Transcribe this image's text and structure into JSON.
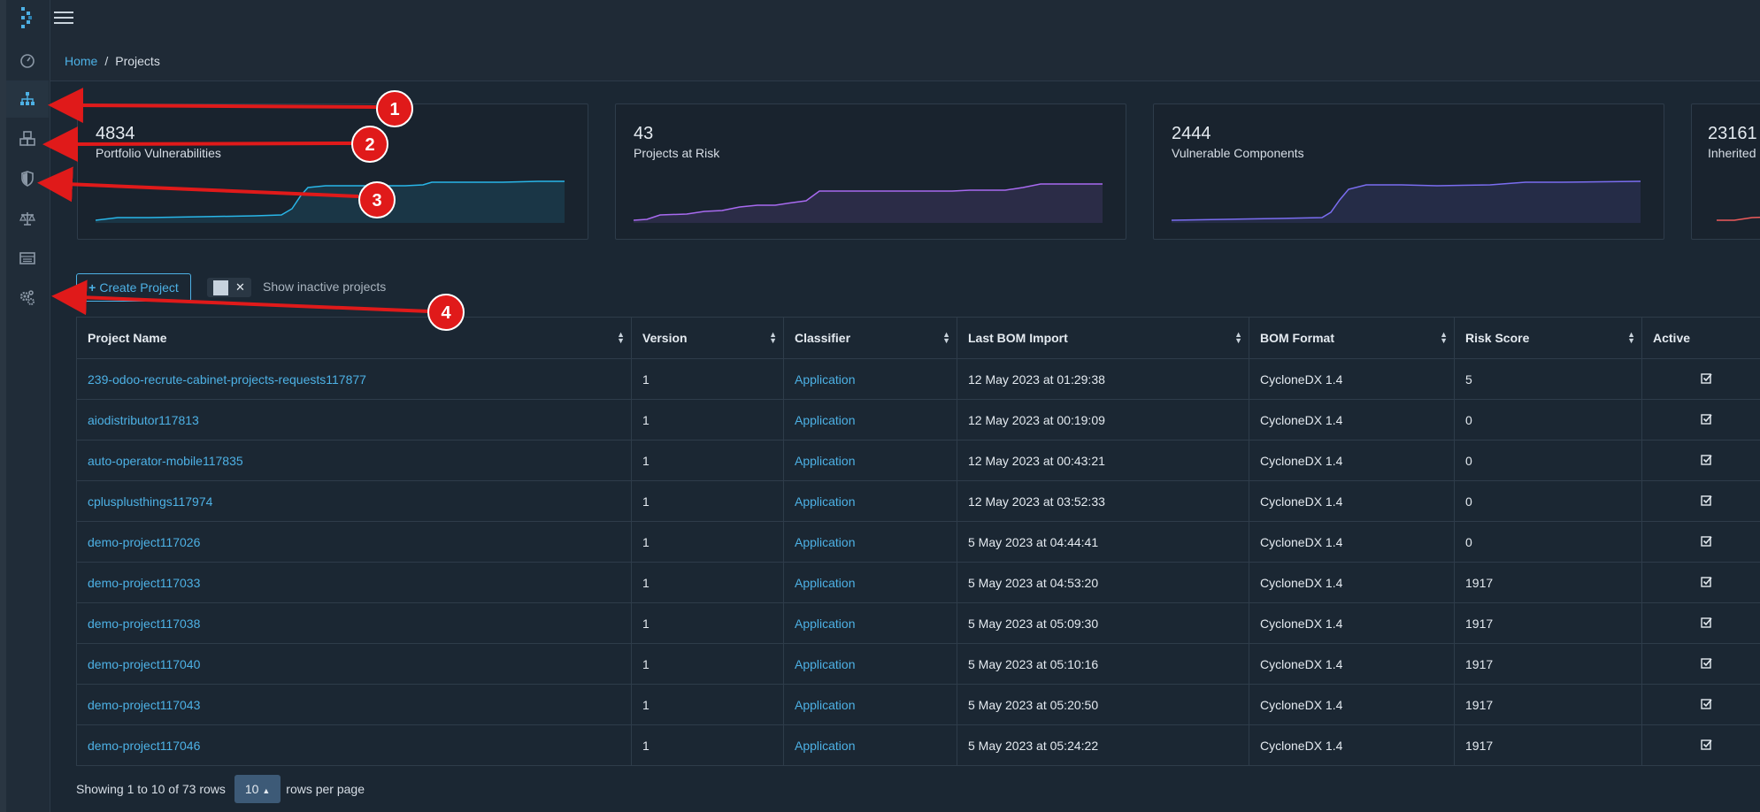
{
  "breadcrumb": {
    "home": "Home",
    "separator": "/",
    "current": "Projects"
  },
  "sidebar": {
    "items": [
      {
        "icon": "dashboard-icon"
      },
      {
        "icon": "projects-icon",
        "active": true
      },
      {
        "icon": "components-icon"
      },
      {
        "icon": "vulnerabilities-icon"
      },
      {
        "icon": "license-icon"
      },
      {
        "icon": "tags-icon"
      },
      {
        "icon": "admin-settings-icon"
      }
    ]
  },
  "metrics": [
    {
      "value": "4834",
      "label": "Portfolio Vulnerabilities",
      "color": "#29b6e8"
    },
    {
      "value": "43",
      "label": "Projects at Risk",
      "color": "#a86af0"
    },
    {
      "value": "2444",
      "label": "Vulnerable Components",
      "color": "#7a6df0"
    },
    {
      "value": "23161",
      "label": "Inherited",
      "color": "#ee5b5b"
    }
  ],
  "toolbar": {
    "create_project": "Create Project",
    "show_inactive_label": "Show inactive projects",
    "toggle_symbol": "✕"
  },
  "table": {
    "headers": [
      "Project Name",
      "Version",
      "Classifier",
      "Last BOM Import",
      "BOM Format",
      "Risk Score",
      "Active"
    ],
    "rows": [
      {
        "name": "239-odoo-recrute-cabinet-projects-requests117877",
        "version": "1",
        "classifier": "Application",
        "last_import": "12 May 2023 at 01:29:38",
        "format": "CycloneDX 1.4",
        "risk": "5"
      },
      {
        "name": "aiodistributor117813",
        "version": "1",
        "classifier": "Application",
        "last_import": "12 May 2023 at 00:19:09",
        "format": "CycloneDX 1.4",
        "risk": "0"
      },
      {
        "name": "auto-operator-mobile117835",
        "version": "1",
        "classifier": "Application",
        "last_import": "12 May 2023 at 00:43:21",
        "format": "CycloneDX 1.4",
        "risk": "0"
      },
      {
        "name": "cplusplusthings117974",
        "version": "1",
        "classifier": "Application",
        "last_import": "12 May 2023 at 03:52:33",
        "format": "CycloneDX 1.4",
        "risk": "0"
      },
      {
        "name": "demo-project117026",
        "version": "1",
        "classifier": "Application",
        "last_import": "5 May 2023 at 04:44:41",
        "format": "CycloneDX 1.4",
        "risk": "0"
      },
      {
        "name": "demo-project117033",
        "version": "1",
        "classifier": "Application",
        "last_import": "5 May 2023 at 04:53:20",
        "format": "CycloneDX 1.4",
        "risk": "1917"
      },
      {
        "name": "demo-project117038",
        "version": "1",
        "classifier": "Application",
        "last_import": "5 May 2023 at 05:09:30",
        "format": "CycloneDX 1.4",
        "risk": "1917"
      },
      {
        "name": "demo-project117040",
        "version": "1",
        "classifier": "Application",
        "last_import": "5 May 2023 at 05:10:16",
        "format": "CycloneDX 1.4",
        "risk": "1917"
      },
      {
        "name": "demo-project117043",
        "version": "1",
        "classifier": "Application",
        "last_import": "5 May 2023 at 05:20:50",
        "format": "CycloneDX 1.4",
        "risk": "1917"
      },
      {
        "name": "demo-project117046",
        "version": "1",
        "classifier": "Application",
        "last_import": "5 May 2023 at 05:24:22",
        "format": "CycloneDX 1.4",
        "risk": "1917"
      }
    ]
  },
  "footer": {
    "showing": "Showing 1 to 10 of 73 rows",
    "page_size": "10",
    "rows_per_page": "rows per page"
  },
  "annotations": [
    "1",
    "2",
    "3",
    "4"
  ]
}
